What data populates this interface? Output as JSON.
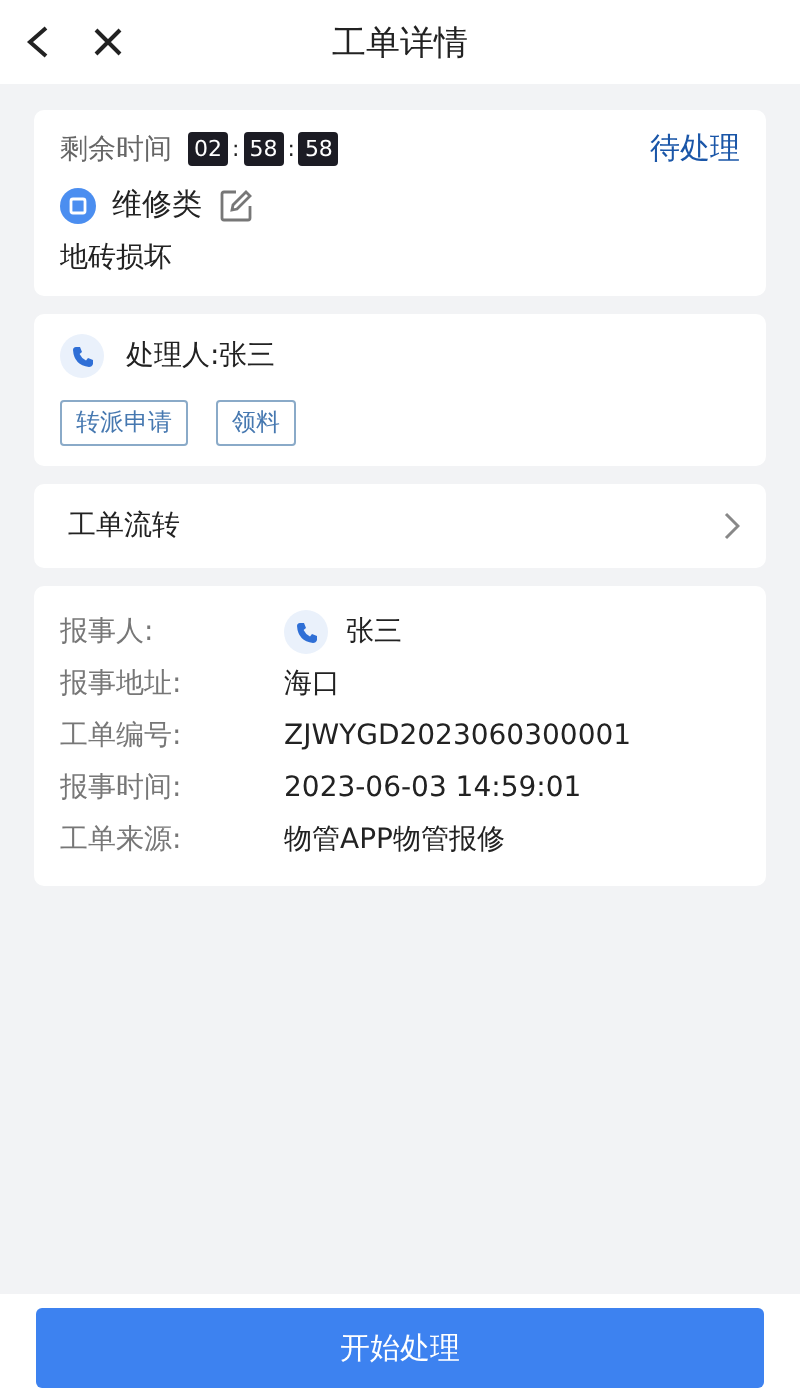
{
  "header": {
    "title": "工单详情"
  },
  "summary": {
    "timer_label": "剩余时间",
    "timer": [
      {
        "kind": "digits",
        "text": "02"
      },
      {
        "kind": "separator",
        "text": ":"
      },
      {
        "kind": "digits",
        "text": "58"
      },
      {
        "kind": "separator",
        "text": ":"
      },
      {
        "kind": "digits",
        "text": "58"
      }
    ],
    "status": "待处理",
    "category": "维修类",
    "description": "地砖损坏"
  },
  "handler": {
    "label": "处理人:张三",
    "actions": [
      "转派申请",
      "领料"
    ]
  },
  "flow": {
    "label": "工单流转"
  },
  "details": [
    {
      "kind": "contact",
      "label": "报事人:",
      "value": "张三"
    },
    {
      "kind": "text",
      "label": "报事地址:",
      "value": "海口"
    },
    {
      "kind": "text",
      "label": "工单编号:",
      "value": "ZJWYGD2023060300001"
    },
    {
      "kind": "text",
      "label": "报事时间:",
      "value": "2023-06-03 14:59:01"
    },
    {
      "kind": "text",
      "label": "工单来源:",
      "value": "物管APP物管报修"
    }
  ],
  "footer": {
    "button": "开始处理"
  }
}
